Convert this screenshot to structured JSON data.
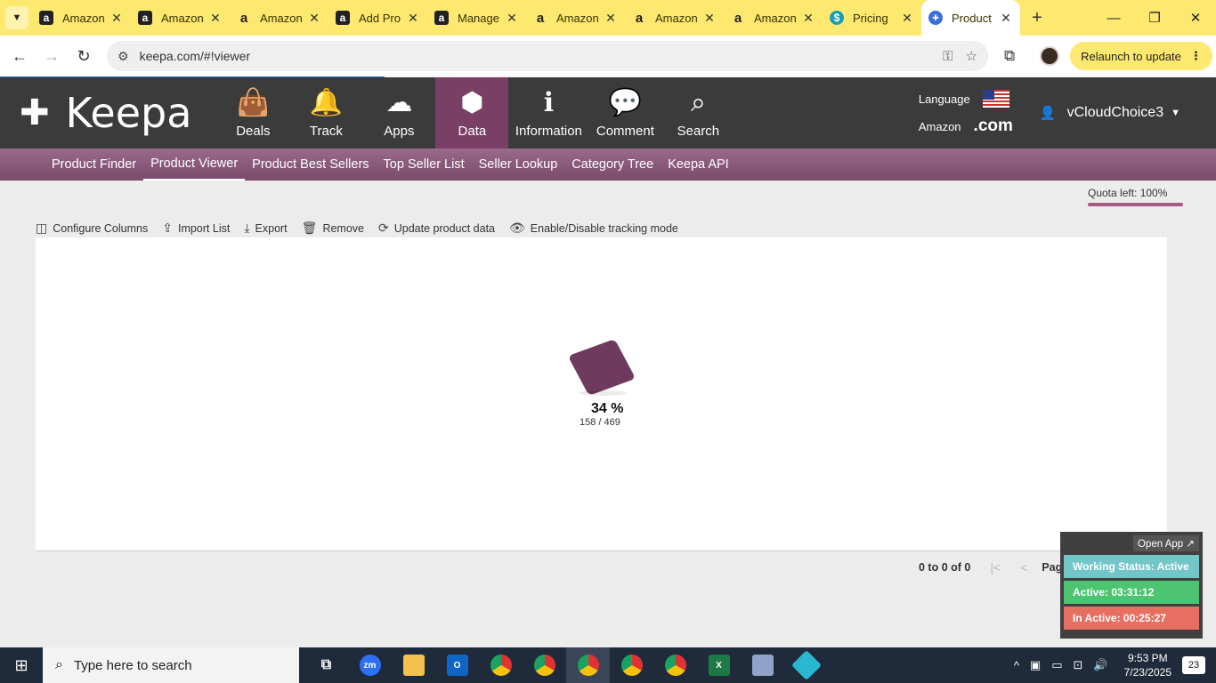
{
  "browser": {
    "tabs": [
      {
        "title": "Amazon",
        "icon": "amazon-dark-icon"
      },
      {
        "title": "Amazon",
        "icon": "amazon-dark-icon"
      },
      {
        "title": "Amazon",
        "icon": "amazon-light-icon"
      },
      {
        "title": "Add Pro",
        "icon": "amazon-dark-icon"
      },
      {
        "title": "Manage",
        "icon": "amazon-dark-icon"
      },
      {
        "title": "Amazon",
        "icon": "amazon-light-icon"
      },
      {
        "title": "Amazon",
        "icon": "amazon-light-icon"
      },
      {
        "title": "Amazon",
        "icon": "amazon-light-icon"
      },
      {
        "title": "Pricing",
        "icon": "pricing-icon"
      },
      {
        "title": "Product",
        "icon": "keepa-icon"
      }
    ],
    "active_tab": 9,
    "url": "keepa.com/#!viewer",
    "relaunch_label": "Relaunch to update"
  },
  "keepa": {
    "logo": "Keepa",
    "nav": [
      {
        "label": "Deals",
        "icon": "shopping-bag-icon"
      },
      {
        "label": "Track",
        "icon": "bell-icon"
      },
      {
        "label": "Apps",
        "icon": "cloud-download-icon"
      },
      {
        "label": "Data",
        "icon": "box-icon"
      },
      {
        "label": "Information",
        "icon": "info-icon"
      },
      {
        "label": "Comment",
        "icon": "comment-icon"
      },
      {
        "label": "Search",
        "icon": "search-icon"
      }
    ],
    "active_nav": "Data",
    "language_label": "Language",
    "amazon_label": "Amazon",
    "domain": ".com",
    "username": "vCloudChoice3",
    "subnav": [
      "Product Finder",
      "Product Viewer",
      "Product Best Sellers",
      "Top Seller List",
      "Seller Lookup",
      "Category Tree",
      "Keepa API"
    ],
    "active_subnav": "Product Viewer",
    "quota": "Quota left: 100%",
    "toolbar": {
      "configure": "Configure Columns",
      "import": "Import List",
      "export": "Export",
      "remove": "Remove",
      "update": "Update product data",
      "tracking": "Enable/Disable tracking mode"
    },
    "progress": {
      "percent_label": "34 %",
      "count_label": "158 / 469",
      "value": 0.34
    },
    "pager": {
      "count": "0 to 0 of 0",
      "page": "Page 0 of 0"
    }
  },
  "widget": {
    "open_app": "Open App ↗",
    "status": "Working Status: Active",
    "active": "Active: 03:31:12",
    "inactive": "In Active: 00:25:27"
  },
  "taskbar": {
    "search_placeholder": "Type here to search",
    "time": "9:53 PM",
    "date": "7/23/2025",
    "notifications": "23"
  },
  "colors": {
    "tabstrip": "#fde870",
    "keepa_header": "#3b3b3b",
    "accent": "#7a3f64",
    "status": "#72c6c8",
    "active": "#4cc471",
    "inactive": "#e66f62"
  }
}
